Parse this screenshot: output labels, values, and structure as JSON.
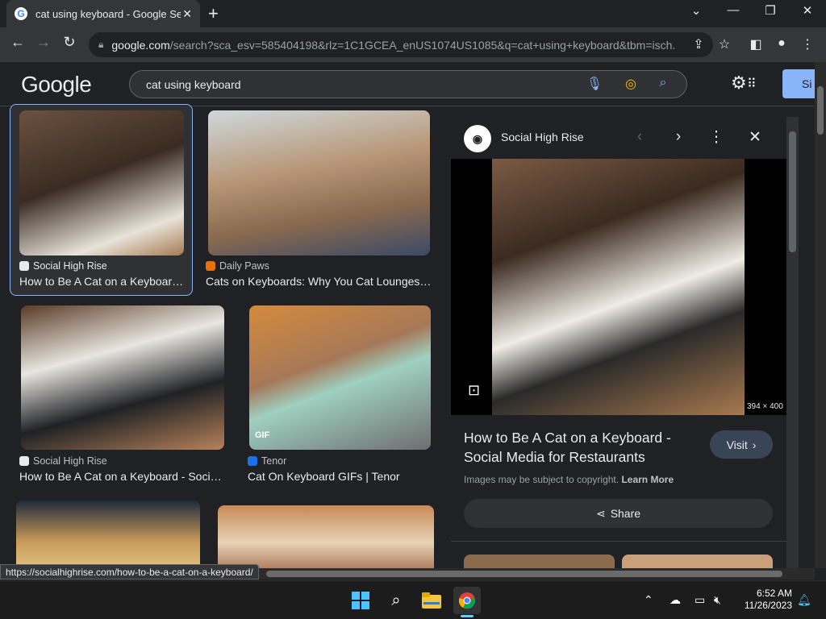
{
  "browser": {
    "tab_title": "cat using keyboard - Google Search",
    "new_tab": "+",
    "url_domain": "google.com",
    "url_path": "/search?sca_esv=585404198&rlz=1C1GCEA_enUS1074US1085&q=cat+using+keyboard&tbm=isch...",
    "window_controls": {
      "minimize": "—",
      "restore": "❐",
      "close": "✕",
      "tab_search": "⌄"
    }
  },
  "google": {
    "logo": "Google",
    "search_value": "cat using keyboard",
    "signin_label": "Si"
  },
  "results": [
    {
      "source": "Social High Rise",
      "title": "How to Be A Cat on a Keyboard - Social Media for Restaurants",
      "source_color": "#e8eaed"
    },
    {
      "source": "Daily Paws",
      "title": "Cats on Keyboards: Why You Cat Lounges on Your Keyboard",
      "source_color": "#e8710a"
    },
    {
      "source": "Social High Rise",
      "title": "How to Be A Cat on a Keyboard - Social Media for Restaurants",
      "source_color": "#e8eaed"
    },
    {
      "source": "Tenor",
      "title": "Cat On Keyboard GIFs | Tenor",
      "source_color": "#1a73e8"
    }
  ],
  "gif_badge": "GIF",
  "panel": {
    "source": "Social High Rise",
    "image_dims": "394 × 400",
    "title": "How to Be A Cat on a Keyboard - Social Media for Restaurants",
    "visit_label": "Visit",
    "copyright_text": "Images may be subject to copyright.",
    "learn_more": "Learn More",
    "share_label": "Share"
  },
  "status_url": "https://socialhighrise.com/how-to-be-a-cat-on-a-keyboard/",
  "taskbar": {
    "time": "6:52 AM",
    "date": "11/26/2023"
  }
}
